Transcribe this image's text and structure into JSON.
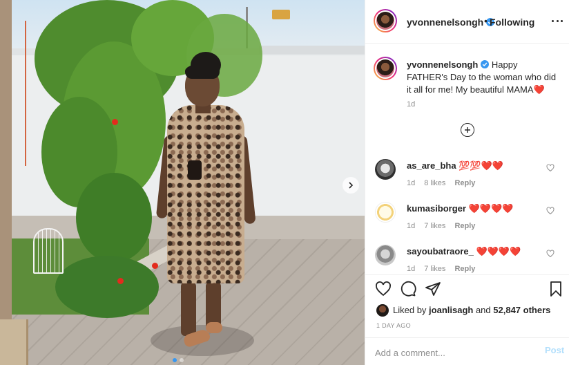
{
  "post": {
    "username": "yvonnenelsongh",
    "bullet": "•",
    "follow_label": "Following",
    "caption_username": "yvonnenelsongh",
    "caption_text": "Happy FATHER's Day to the woman who did it all for me! My beautiful MAMA",
    "caption_emoji": "❤️",
    "caption_time": "1d"
  },
  "comments": [
    {
      "user": "as_are_bha",
      "emoji": "💯💯❤️❤️",
      "time": "1d",
      "likes": "8 likes",
      "reply": "Reply"
    },
    {
      "user": "kumasiborger",
      "emoji": "❤️❤️❤️❤️",
      "time": "1d",
      "likes": "7 likes",
      "reply": "Reply"
    },
    {
      "user": "sayoubatraore_",
      "emoji": "❤️❤️❤️❤️",
      "time": "1d",
      "likes": "7 likes",
      "reply": "Reply"
    }
  ],
  "likes": {
    "prefix": "Liked by ",
    "user": "joanlisagh",
    "middle": " and ",
    "count": "52,847 others"
  },
  "post_age": "1 DAY AGO",
  "add_comment": {
    "placeholder": "Add a comment...",
    "post_label": "Post"
  },
  "carousel": {
    "total": 2,
    "active_index": 0
  },
  "colors": {
    "accent_blue": "#3897f0",
    "heart_red": "#ed1c24",
    "text": "#262626",
    "muted": "#8e8e8e",
    "post_disabled": "#b2dffc"
  },
  "icons": [
    "more-icon",
    "verified-icon",
    "load-more-icon",
    "heart-icon",
    "comment-icon",
    "share-icon",
    "bookmark-icon",
    "chevron-right-icon"
  ]
}
